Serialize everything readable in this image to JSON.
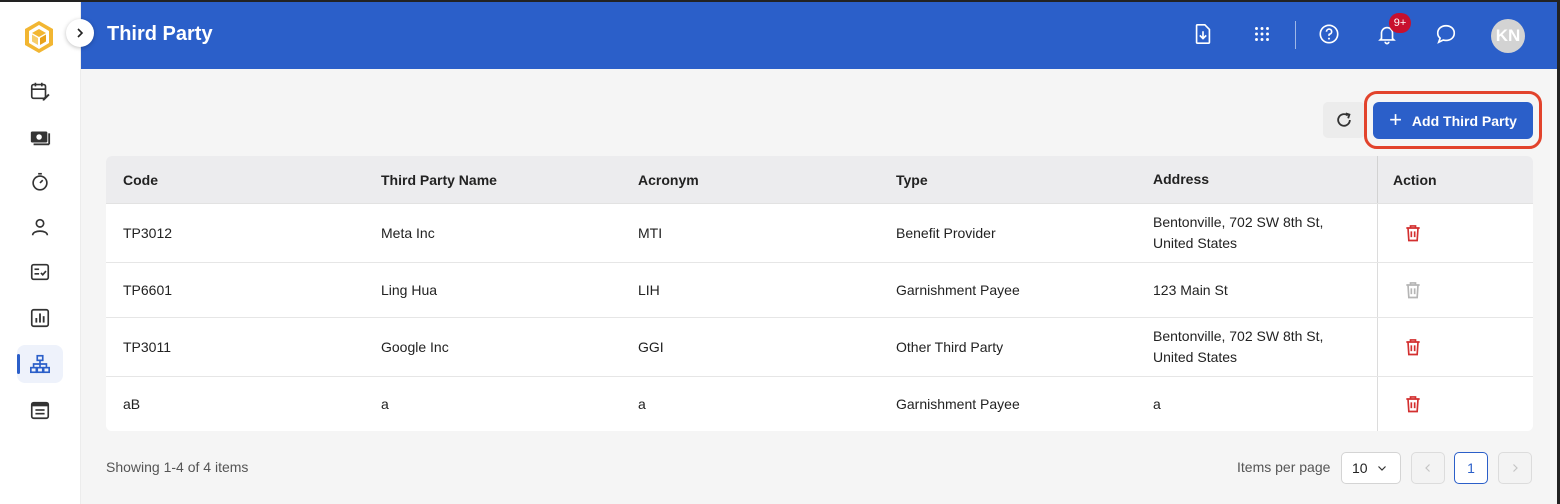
{
  "header": {
    "title": "Third Party",
    "notification_badge": "9+",
    "avatar_initials": "KN"
  },
  "sidebar": {
    "items": [
      {
        "name": "calendar-edit",
        "active": false
      },
      {
        "name": "payroll-cash",
        "active": false
      },
      {
        "name": "timer",
        "active": false
      },
      {
        "name": "person",
        "active": false
      },
      {
        "name": "checklist",
        "active": false
      },
      {
        "name": "reports-chart",
        "active": false
      },
      {
        "name": "org-structure",
        "active": true
      },
      {
        "name": "schedule",
        "active": false
      }
    ]
  },
  "toolbar": {
    "add_label": "Add Third Party"
  },
  "table": {
    "headers": {
      "code": "Code",
      "name": "Third Party Name",
      "acronym": "Acronym",
      "type": "Type",
      "address": "Address",
      "action": "Action"
    },
    "rows": [
      {
        "code": "TP3012",
        "name": "Meta Inc",
        "acronym": "MTI",
        "type": "Benefit Provider",
        "address": "Bentonville, 702 SW 8th St, United States",
        "deletable": true
      },
      {
        "code": "TP6601",
        "name": "Ling Hua",
        "acronym": "LIH",
        "type": "Garnishment Payee",
        "address": "123 Main St",
        "deletable": false
      },
      {
        "code": "TP3011",
        "name": "Google Inc",
        "acronym": "GGI",
        "type": "Other Third Party",
        "address": "Bentonville, 702 SW 8th St, United States",
        "deletable": true
      },
      {
        "code": "aB",
        "name": "a",
        "acronym": "a",
        "type": "Garnishment Payee",
        "address": "a",
        "deletable": true
      }
    ]
  },
  "footer": {
    "showing": "Showing 1-4 of 4 items",
    "items_per_page_label": "Items per page",
    "items_per_page_value": "10",
    "current_page": "1"
  },
  "colors": {
    "primary": "#2b5fc9",
    "danger": "#d32f2f",
    "disabled": "#b5b5b5",
    "highlight": "#e2432c"
  }
}
